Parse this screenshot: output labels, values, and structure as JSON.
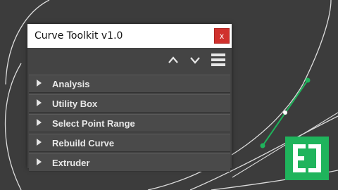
{
  "window": {
    "title": "Curve Toolkit v1.0",
    "close_label": "x"
  },
  "toolbar": {
    "icons": [
      "chevron-up-icon",
      "chevron-down-icon",
      "menu-icon"
    ]
  },
  "sections": [
    {
      "label": "Analysis"
    },
    {
      "label": "Utility Box"
    },
    {
      "label": "Select Point Range"
    },
    {
      "label": "Rebuild Curve"
    },
    {
      "label": "Extruder"
    }
  ],
  "colors": {
    "accent": "#1fb45c",
    "close": "#d0312d",
    "panel": "#444444",
    "background": "#3c3c3c"
  }
}
